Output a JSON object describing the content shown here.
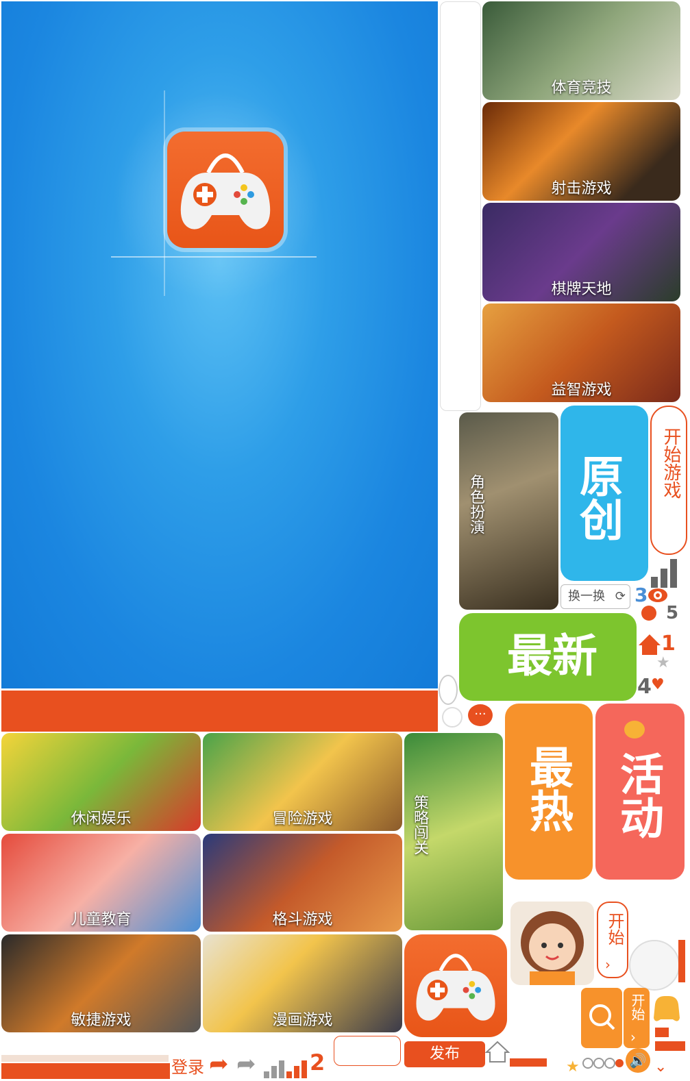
{
  "categories_right": [
    {
      "label": "体育竞技"
    },
    {
      "label": "射击游戏"
    },
    {
      "label": "棋牌天地"
    },
    {
      "label": "益智游戏"
    }
  ],
  "role_play_label": "角色扮演",
  "tiles": {
    "original": "原创",
    "newest": "最新",
    "hottest": "最热",
    "activity": "活动"
  },
  "start_game_label": "开始游戏",
  "refresh_label": "换一换",
  "numbers": {
    "n3": "3",
    "n5": "5",
    "n1": "1",
    "n4": "4",
    "n2": "2"
  },
  "grid": [
    {
      "label": "休闲娱乐"
    },
    {
      "label": "冒险游戏"
    },
    {
      "label": "儿童教育"
    },
    {
      "label": "格斗游戏"
    },
    {
      "label": "敏捷游戏"
    },
    {
      "label": "漫画游戏"
    }
  ],
  "strategy_label": "策略闯关",
  "start_short_1": "开始",
  "start_short_2": "开始",
  "bottom": {
    "login": "登录",
    "publish": "发布"
  },
  "colors": {
    "brand": "#e8501f",
    "blue": "#1b86e0",
    "green": "#7dc52e",
    "orange": "#f7922b",
    "coral": "#f5675b"
  }
}
